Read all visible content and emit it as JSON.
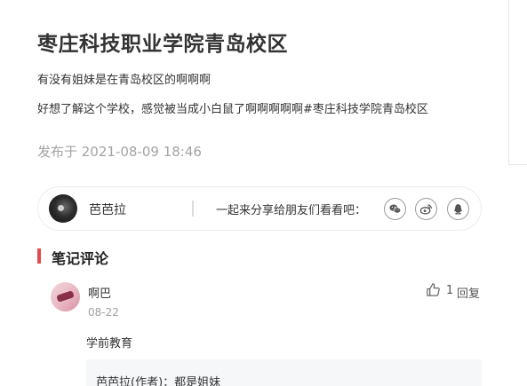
{
  "note": {
    "title": "枣庄科技职业学院青岛校区",
    "subtitle": "有没有姐妹是在青岛校区的啊啊啊",
    "body": "好想了解这个学校，感觉被当成小白鼠了啊啊啊啊啊#枣庄科技学院青岛校区",
    "published": "发布于 2021-08-09 18:46"
  },
  "author": {
    "name": "芭芭拉",
    "share_label": "一起来分享给朋友们看看吧：",
    "share_icons": [
      "wechat-icon",
      "weibo-icon",
      "qq-icon"
    ]
  },
  "comments_section": {
    "title": "笔记评论",
    "accent_color": "#e24a4f"
  },
  "comments": [
    {
      "name": "啊巴",
      "date": "08-22",
      "likes": "1",
      "reply_label": "回复",
      "text": "学前教育",
      "replies": [
        {
          "text": "芭芭拉(作者)：都是姐妹"
        }
      ]
    }
  ]
}
